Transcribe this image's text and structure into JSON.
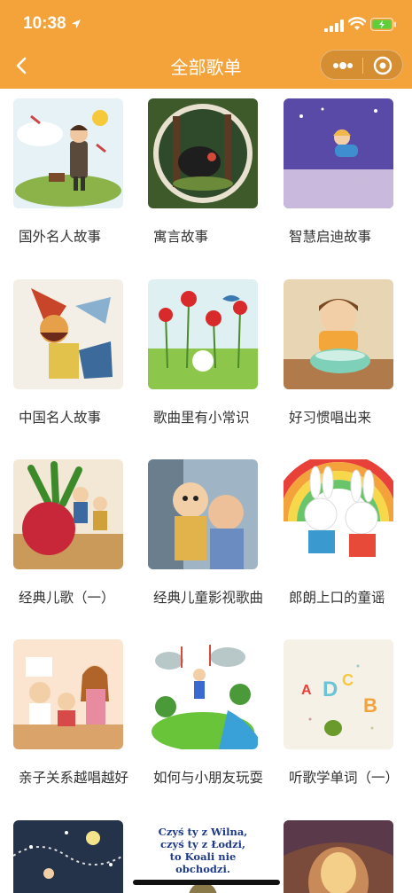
{
  "status_bar": {
    "time": "10:38"
  },
  "nav": {
    "title": "全部歌单"
  },
  "playlists": [
    {
      "label": "国外名人故事",
      "icon": "scientist-illustration"
    },
    {
      "label": "寓言故事",
      "icon": "forest-fable-illustration"
    },
    {
      "label": "智慧启迪故事",
      "icon": "moon-girl-illustration"
    },
    {
      "label": "中国名人故事",
      "icon": "opera-hero-illustration"
    },
    {
      "label": "歌曲里有小常识",
      "icon": "poppy-field-illustration"
    },
    {
      "label": "好习惯唱出来",
      "icon": "girl-washing-illustration"
    },
    {
      "label": "经典儿歌（一）",
      "icon": "big-radish-illustration"
    },
    {
      "label": "经典儿童影视歌曲",
      "icon": "cartoon-kids-illustration"
    },
    {
      "label": "郎朗上口的童谣",
      "icon": "rainbow-bunnies-illustration"
    },
    {
      "label": "亲子关系越唱越好",
      "icon": "kitchen-family-illustration"
    },
    {
      "label": "如何与小朋友玩耍",
      "icon": "rain-garden-illustration"
    },
    {
      "label": "听歌学单词（一）",
      "icon": "alphabet-letters-illustration"
    },
    {
      "label": "",
      "icon": "night-sky-illustration"
    },
    {
      "label": "",
      "icon": "polish-book-cover",
      "cover_text": "Czyś ty z Wilna, czyś ty z Łodzi, to Koali nie obchodzi."
    },
    {
      "label": "",
      "icon": "cave-illustration"
    }
  ]
}
